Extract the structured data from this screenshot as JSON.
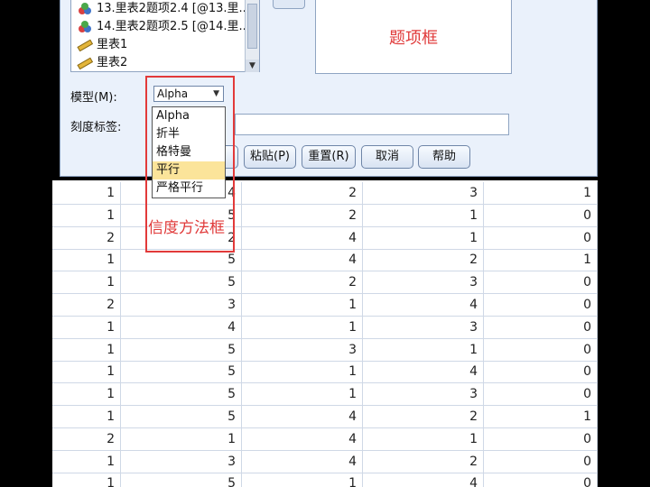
{
  "variable_list": {
    "items": [
      {
        "icon": "nominal-icon",
        "label": "13.里表2题项2.4 [@13.里..."
      },
      {
        "icon": "nominal-icon",
        "label": "14.里表2题项2.5 [@14.里..."
      },
      {
        "icon": "scale-icon",
        "label": "里表1"
      },
      {
        "icon": "scale-icon",
        "label": "里表2"
      }
    ]
  },
  "items_box": {
    "annotation": "题项框"
  },
  "model": {
    "label": "模型(M):",
    "value": "Alpha",
    "options": [
      "Alpha",
      "折半",
      "格特曼",
      "平行",
      "严格平行"
    ],
    "highlighted_option": "平行"
  },
  "scale_label": {
    "label": "刻度标签:",
    "value": ""
  },
  "buttons": {
    "paste": "粘贴(P)",
    "reset": "重置(R)",
    "cancel": "取消",
    "help": "帮助"
  },
  "annotation": {
    "text": "信度方法框",
    "color": "#e03a3a"
  },
  "grid": {
    "rows": [
      [
        "1",
        "4",
        "2",
        "3",
        "1"
      ],
      [
        "1",
        "5",
        "2",
        "1",
        "0"
      ],
      [
        "2",
        "2",
        "4",
        "1",
        "0"
      ],
      [
        "1",
        "5",
        "4",
        "2",
        "1"
      ],
      [
        "1",
        "5",
        "2",
        "3",
        "0"
      ],
      [
        "2",
        "3",
        "1",
        "4",
        "0"
      ],
      [
        "1",
        "4",
        "1",
        "3",
        "0"
      ],
      [
        "1",
        "5",
        "3",
        "1",
        "0"
      ],
      [
        "1",
        "5",
        "1",
        "4",
        "0"
      ],
      [
        "1",
        "5",
        "1",
        "3",
        "0"
      ],
      [
        "1",
        "5",
        "4",
        "2",
        "1"
      ],
      [
        "2",
        "1",
        "4",
        "1",
        "0"
      ],
      [
        "1",
        "3",
        "4",
        "2",
        "0"
      ],
      [
        "1",
        "5",
        "1",
        "4",
        "0"
      ]
    ]
  }
}
